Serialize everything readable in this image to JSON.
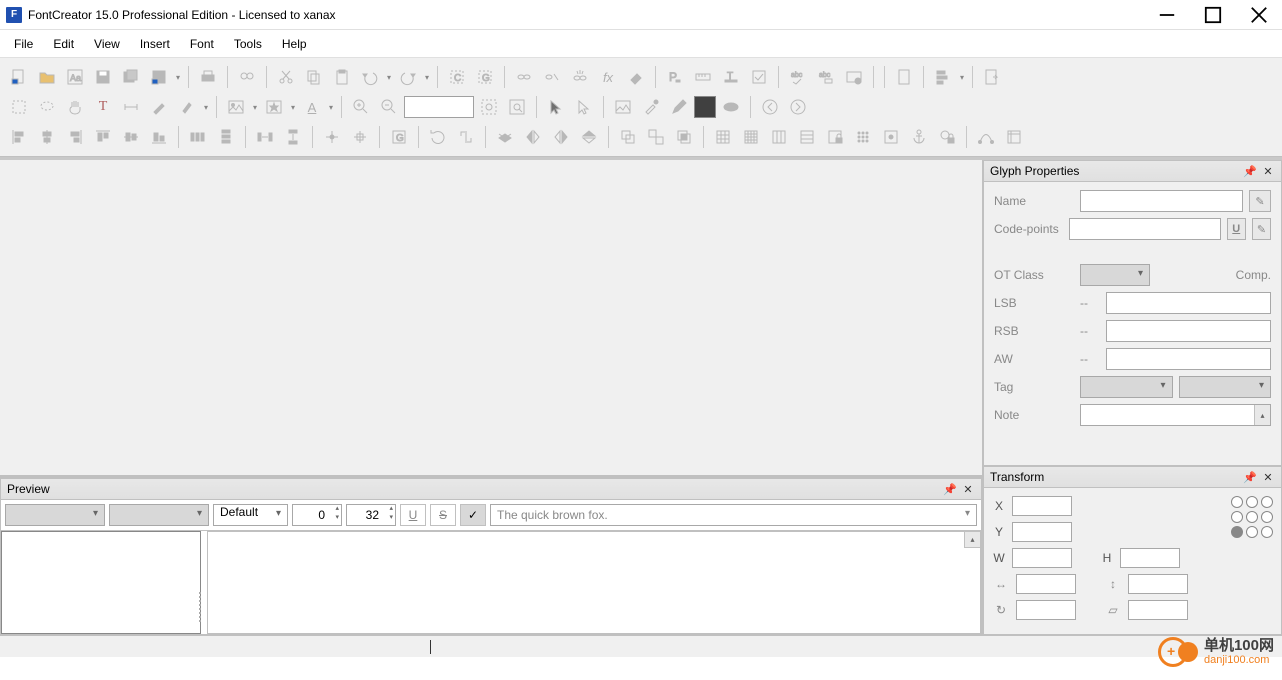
{
  "window": {
    "title": "FontCreator 15.0 Professional Edition - Licensed to xanax",
    "app_abbrev": "F"
  },
  "menubar": [
    "File",
    "Edit",
    "View",
    "Insert",
    "Font",
    "Tools",
    "Help"
  ],
  "toolbar": {
    "row1_icons": [
      "new-font",
      "open-font",
      "glyph-preview",
      "save",
      "save-all",
      "save-as-dropdown",
      "sep",
      "print",
      "sep",
      "find",
      "sep",
      "cut",
      "copy",
      "paste",
      "undo-dropdown",
      "redo-dropdown",
      "sep",
      "complete-composite",
      "complete-glyph",
      "sep",
      "link",
      "unlink",
      "break-link",
      "fx",
      "erase",
      "sep",
      "paragraph",
      "ruler",
      "text-width",
      "checkbox",
      "sep",
      "spellcheck-abc",
      "spellcheck-toggle",
      "validate-font",
      "sep",
      "sep",
      "new-doc",
      "sep",
      "sort-dropdown",
      "sep",
      "export"
    ],
    "row2_icons": [
      "marquee-select",
      "lasso",
      "pan",
      "text-tool",
      "measure",
      "pen",
      "brush-dropdown",
      "sep",
      "image-dropdown",
      "smart-dropdown",
      "text-effect-dropdown",
      "sep",
      "zoom-in",
      "zoom-out",
      "zoom-input",
      "zoom-fit",
      "zoom-selection",
      "sep",
      "pointer-black",
      "pointer-outline",
      "sep",
      "place-image",
      "eyedropper",
      "pencil",
      "color-swatch",
      "ellipse",
      "sep",
      "nav-back",
      "nav-forward"
    ],
    "row3_icons": [
      "align-left-obj",
      "align-center-obj",
      "align-right-obj",
      "align-top-obj",
      "align-middle-obj",
      "align-bottom-obj",
      "sep",
      "distribute-h",
      "distribute-v",
      "sep",
      "spacing-h",
      "spacing-v",
      "sep",
      "align-to-glyph",
      "sep",
      "rotate-cw",
      "flip-tool",
      "sep",
      "send-back",
      "flip-h",
      "flip-h2",
      "flip-v",
      "sep",
      "group",
      "ungroup",
      "intersect",
      "sep",
      "grid-3x3",
      "grid-4x4",
      "grid-cols",
      "grid-rows",
      "grid-lock",
      "grid-dots",
      "grid-anchor",
      "anchor",
      "guide-lock",
      "sep",
      "path-tool",
      "snap-box"
    ],
    "zoom_value": ""
  },
  "panels": {
    "glyph_properties": {
      "title": "Glyph Properties",
      "fields": {
        "name_label": "Name",
        "codepoints_label": "Code-points",
        "otclass_label": "OT Class",
        "comp_label": "Comp.",
        "lsb_label": "LSB",
        "rsb_label": "RSB",
        "aw_label": "AW",
        "tag_label": "Tag",
        "note_label": "Note",
        "dash": "--"
      }
    },
    "transform": {
      "title": "Transform",
      "labels": {
        "x": "X",
        "y": "Y",
        "w": "W",
        "h": "H"
      }
    },
    "preview": {
      "title": "Preview",
      "mode": "Default",
      "value1": "0",
      "value2": "32",
      "sample_text": "The quick brown fox."
    }
  },
  "watermark": {
    "cn": "单机100网",
    "en": "danji100.com"
  }
}
